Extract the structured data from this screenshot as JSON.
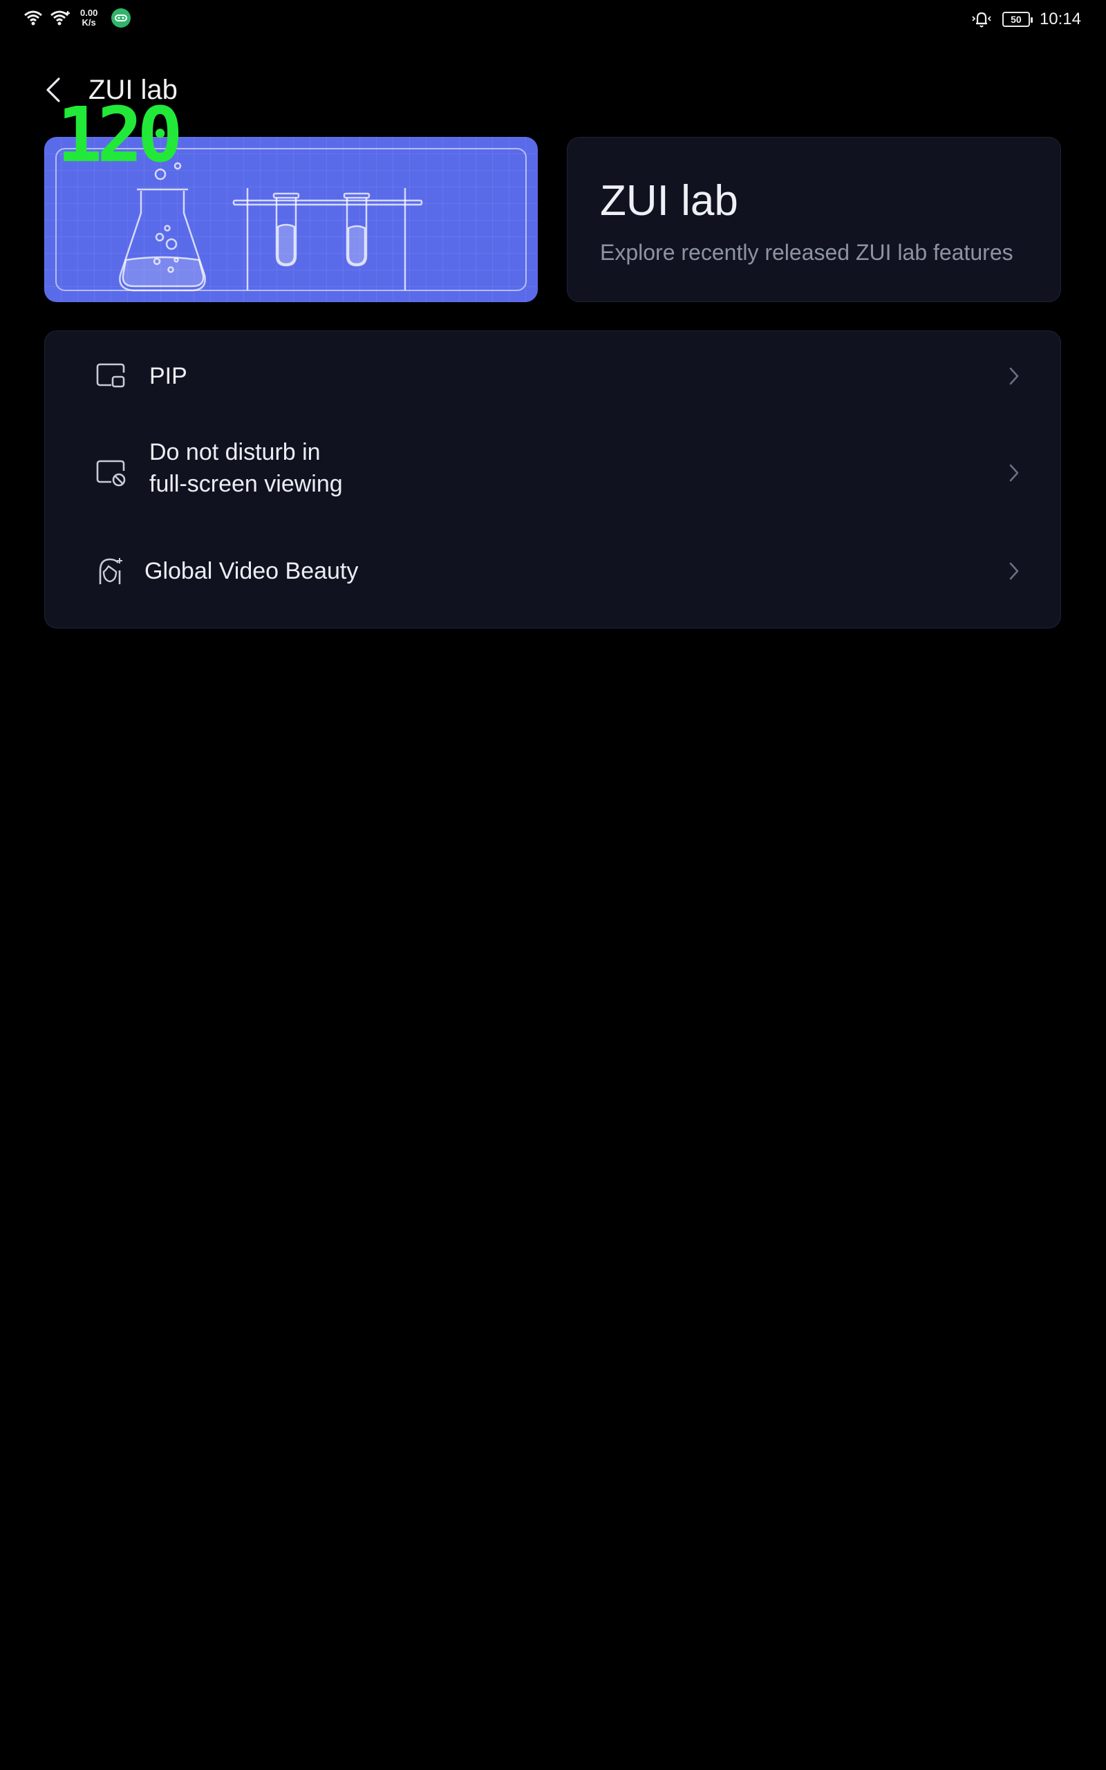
{
  "status_bar": {
    "net_speed_value": "0.00",
    "net_speed_unit": "K/s",
    "battery_level": "50",
    "time": "10:14"
  },
  "header": {
    "title": "ZUI lab"
  },
  "fps_overlay": "120",
  "hero": {
    "title": "ZUI lab",
    "subtitle": "Explore recently released ZUI lab features",
    "image_color": "#5a6bea"
  },
  "settings": {
    "items": [
      {
        "label": "PIP",
        "icon": "pip-icon"
      },
      {
        "label_line1": "Do not disturb in",
        "label_line2": "full-screen viewing",
        "icon": "dnd-fullscreen-icon"
      },
      {
        "label": "Global Video Beauty",
        "icon": "face-beauty-icon"
      }
    ]
  },
  "colors": {
    "background": "#000000",
    "card": "#10131f",
    "accent": "#5a6bea",
    "fps_green": "#22e83a"
  }
}
